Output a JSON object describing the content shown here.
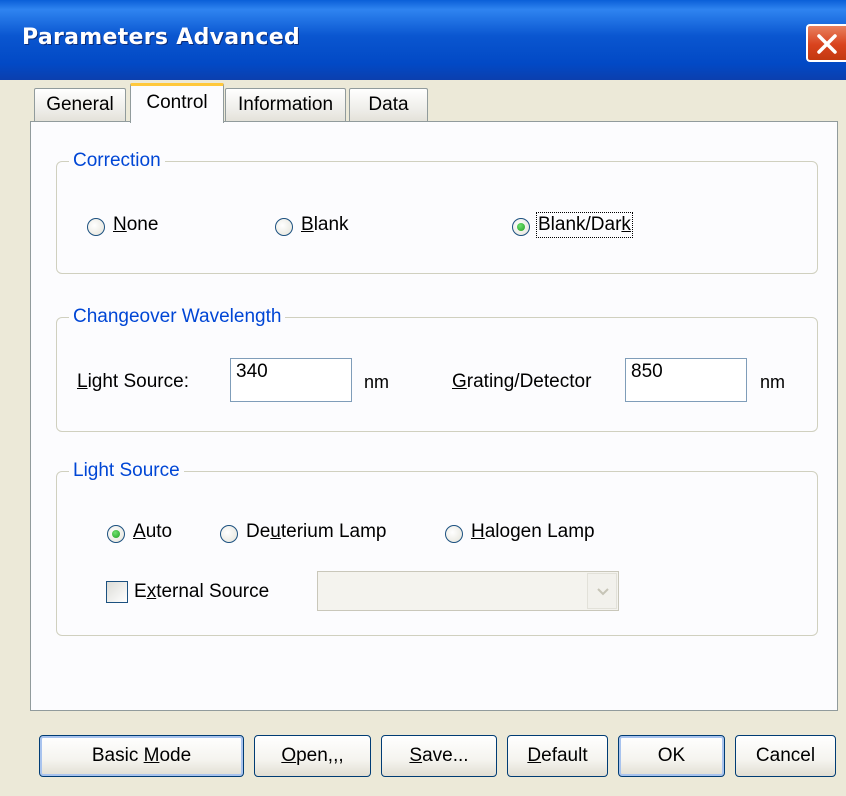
{
  "window": {
    "title": "Parameters  Advanced"
  },
  "tabs": [
    {
      "label": "General",
      "active": false
    },
    {
      "label": "Control",
      "active": true
    },
    {
      "label": "Information",
      "active": false
    },
    {
      "label": "Data",
      "active": false
    }
  ],
  "correction": {
    "legend": "Correction",
    "options": [
      {
        "label": "None",
        "mnemonic": "N",
        "rest": "one",
        "selected": false
      },
      {
        "label": "Blank",
        "mnemonic": "B",
        "rest": "lank",
        "selected": false
      },
      {
        "label": "Blank/Dark",
        "pre": "Blank/Dar",
        "mnemonic": "k",
        "selected": true
      }
    ]
  },
  "changeover": {
    "legend": "Changeover Wavelength",
    "light_source": {
      "label_mn": "L",
      "label_rest": "ight Source:",
      "value": "340",
      "unit": "nm"
    },
    "grating": {
      "label_mn": "G",
      "label_rest": "rating/Detector",
      "value": "850",
      "unit": "nm"
    }
  },
  "light_source": {
    "legend": "Light Source",
    "options": [
      {
        "label": "Auto",
        "pre": "",
        "mnemonic": "A",
        "rest": "uto",
        "selected": true
      },
      {
        "label": "Deuterium Lamp",
        "pre": "De",
        "mnemonic": "u",
        "rest": "terium Lamp",
        "selected": false
      },
      {
        "label": "Halogen Lamp",
        "pre": "",
        "mnemonic": "H",
        "rest": "alogen Lamp",
        "selected": false
      }
    ],
    "external": {
      "label": "External Source",
      "pre": "E",
      "mnemonic": "x",
      "rest": "ternal Source",
      "checked": false,
      "selected_value": ""
    }
  },
  "buttons": {
    "basic_mode": {
      "pre": "Basic ",
      "mnemonic": "M",
      "rest": "ode"
    },
    "open": {
      "mnemonic": "O",
      "rest": "pen,,,"
    },
    "save": {
      "mnemonic": "S",
      "rest": "ave..."
    },
    "default": {
      "mnemonic": "D",
      "rest": "efault"
    },
    "ok": {
      "label": "OK"
    },
    "cancel": {
      "label": "Cancel"
    }
  },
  "colors": {
    "titlebar": "#0a56d0",
    "legend_text": "#0046d5",
    "close_button": "#d9431e",
    "active_tab_accent": "#ffc83c"
  }
}
